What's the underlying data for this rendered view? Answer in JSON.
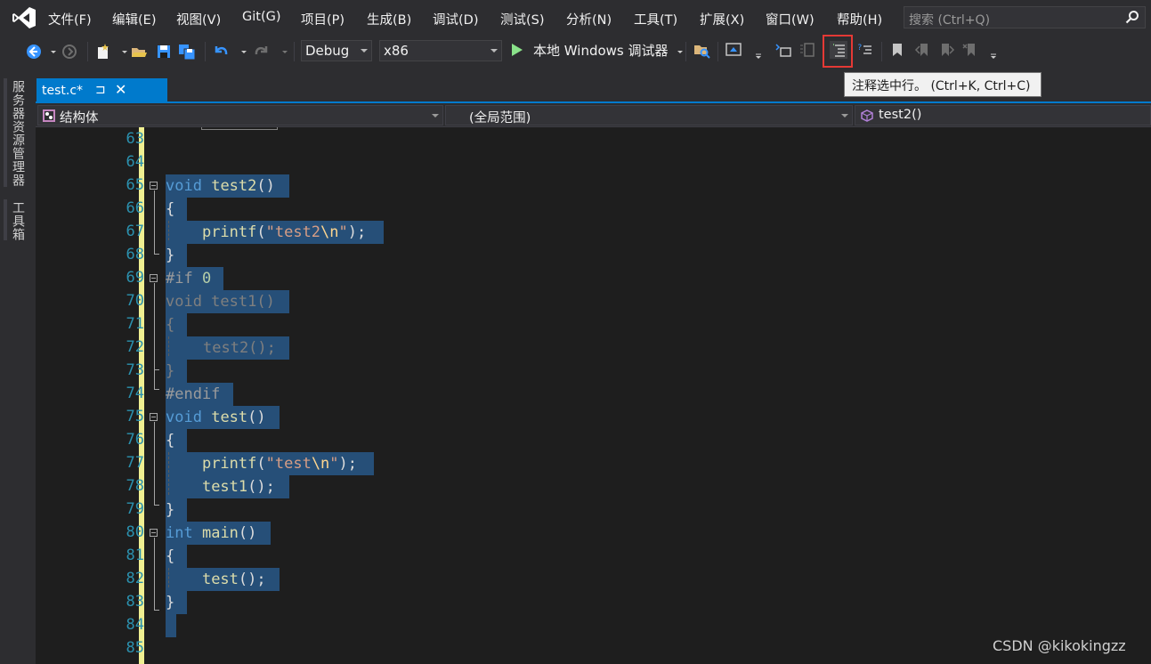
{
  "menu": [
    "文件(F)",
    "编辑(E)",
    "视图(V)",
    "Git(G)",
    "项目(P)",
    "生成(B)",
    "调试(D)",
    "测试(S)",
    "分析(N)",
    "工具(T)",
    "扩展(X)",
    "窗口(W)",
    "帮助(H)"
  ],
  "search": {
    "placeholder": "搜索 (Ctrl+Q)"
  },
  "toolbar": {
    "config": "Debug",
    "platform": "x86",
    "run_label": "本地 Windows 调试器"
  },
  "tooltip": "注释选中行。 (Ctrl+K, Ctrl+C)",
  "side_tabs": [
    "服务器资源管理器",
    "工具箱"
  ],
  "tab": {
    "label": "test.c*",
    "pin": "⊐",
    "close": "✕"
  },
  "nav": {
    "left": "结构体",
    "middle": "(全局范围)",
    "right": "test2()"
  },
  "line_numbers": [
    "63",
    "64",
    "65",
    "66",
    "67",
    "68",
    "69",
    "70",
    "71",
    "72",
    "73",
    "74",
    "75",
    "76",
    "77",
    "78",
    "79",
    "80",
    "81",
    "82",
    "83",
    "84",
    "85"
  ],
  "code": {
    "l65": {
      "kw": "void",
      "fn": "test2",
      "p": "()"
    },
    "l66": "{",
    "l67": {
      "fn": "printf",
      "p1": "(",
      "s1": "\"test2",
      "esc": "\\n",
      "s2": "\"",
      "p2": ");"
    },
    "l68": "}",
    "l69": {
      "pp": "#if",
      "num": "0"
    },
    "l70": "void test1()",
    "l71": "{",
    "l72": "test2();",
    "l73": "}",
    "l74": "#endif",
    "l75": {
      "kw": "void",
      "fn": "test",
      "p": "()"
    },
    "l76": "{",
    "l77": {
      "fn": "printf",
      "p1": "(",
      "s1": "\"test",
      "esc": "\\n",
      "s2": "\"",
      "p2": ");"
    },
    "l78": {
      "fn": "test1",
      "p": "();"
    },
    "l79": "}",
    "l80": {
      "kw": "int",
      "fn": "main",
      "p": "()"
    },
    "l81": "{",
    "l82": {
      "fn": "test",
      "p": "();"
    },
    "l83": "}"
  },
  "watermark": "CSDN @kikokingzz",
  "colors": {
    "accent": "#007acc",
    "selection": "#264f78",
    "highlight": "#e53935"
  }
}
